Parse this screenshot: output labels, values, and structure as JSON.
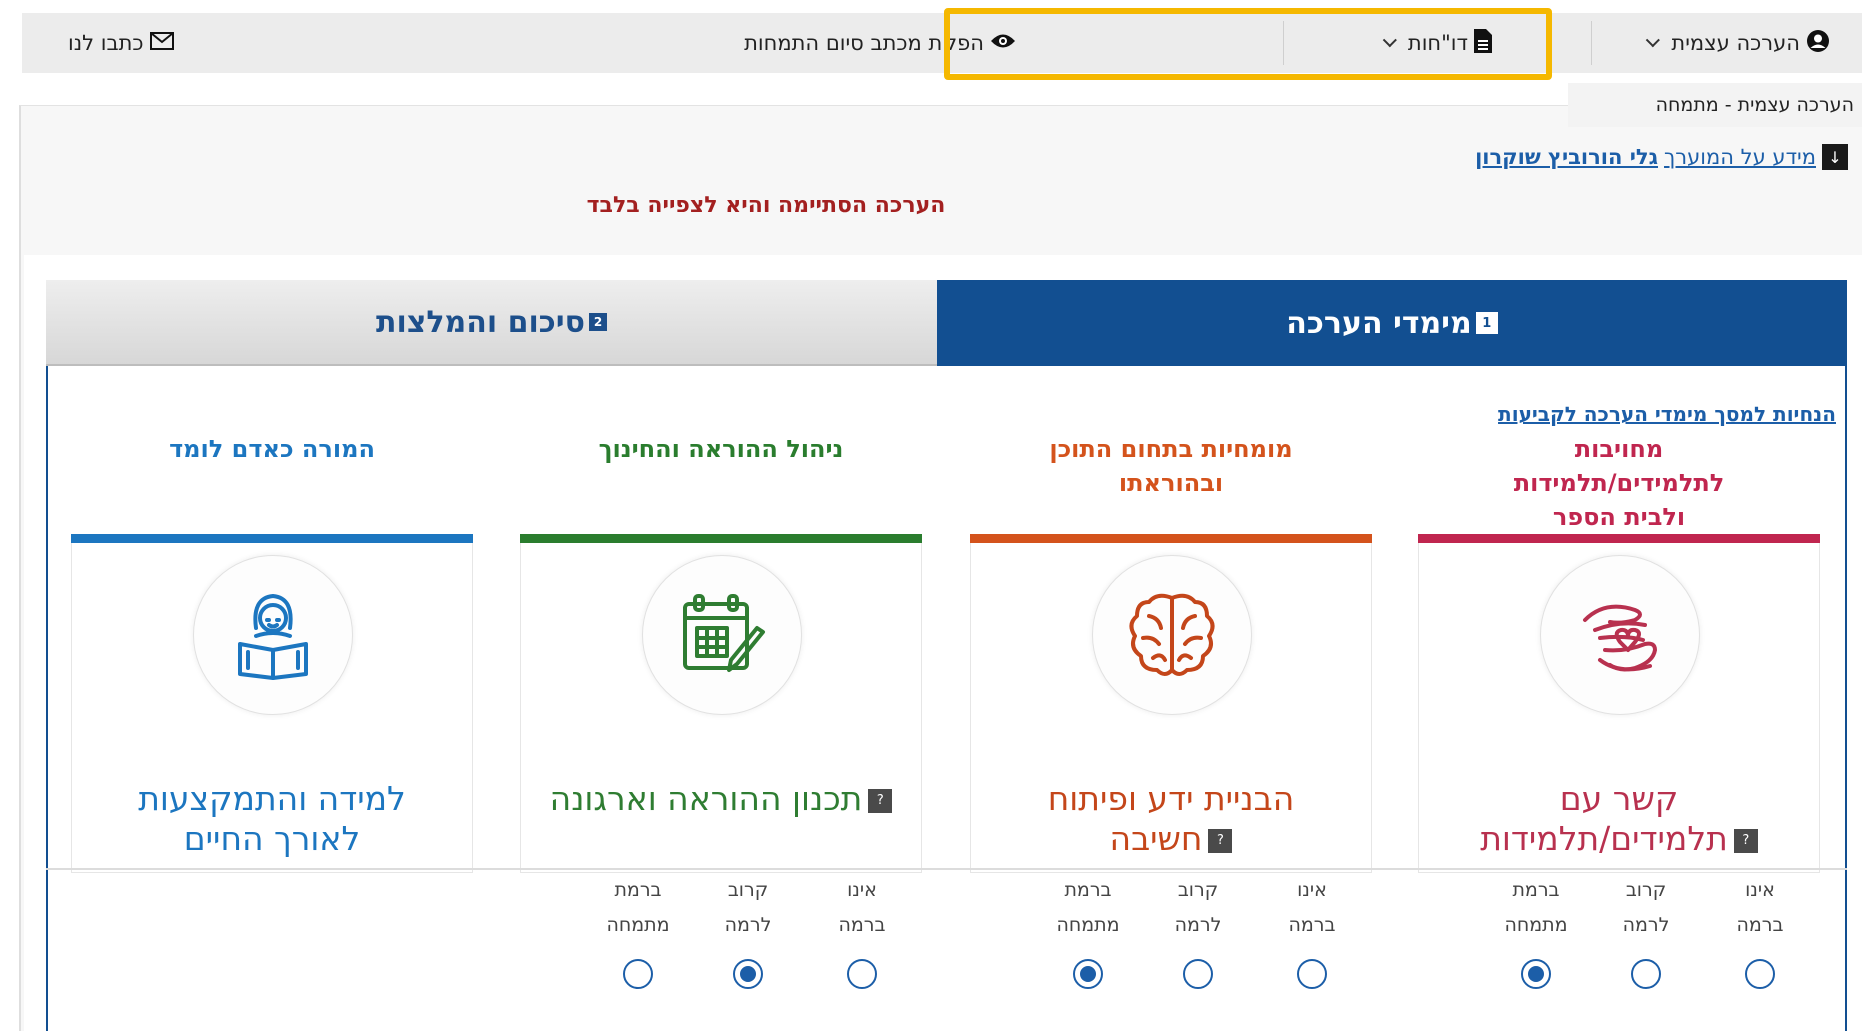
{
  "nav": {
    "self_eval": "הערכה עצמית",
    "reports": "דו\"חות",
    "completion_letter": "הפקת מכתב סיום התמחות",
    "contact": "כתבו לנו",
    "dropdown_item": "הערכה עצמית - מתמחה"
  },
  "appraisee": {
    "label": "מידע על המוערך",
    "name": "גלי הורוביץ שוקרון"
  },
  "status_message": "הערכה הסתיימה והיא לצפייה בלבד",
  "tabs": [
    {
      "num": "1",
      "label": "מימדי הערכה"
    },
    {
      "num": "2",
      "label": "סיכום והמלצות"
    }
  ],
  "guide_link": "הנחיות למסך מימדי הערכה לקביעות",
  "columns": [
    {
      "title": "מחויבות לתלמידים/תלמידות ולבית הספר",
      "title_lines": [
        "מחויבות",
        "לתלמידים/תלמידות",
        "ולבית הספר"
      ],
      "color": "#c0264f",
      "card_title_lines": [
        "קשר עם",
        "תלמידים/תלמידות"
      ],
      "icon": "heart-hands-icon",
      "has_help": true,
      "selected": "ברמת מתמחה"
    },
    {
      "title": "מומחיות בתחום התוכן ובהוראתו",
      "title_lines": [
        "מומחיות בתחום התוכן",
        "ובהוראתו"
      ],
      "color": "#d4531c",
      "card_title_lines": [
        "הבניית ידע ופיתוח",
        "חשיבה"
      ],
      "icon": "brain-icon",
      "has_help": true,
      "selected": "ברמת מתמחה"
    },
    {
      "title": "ניהול ההוראה והחינוך",
      "title_lines": [
        "ניהול ההוראה והחינוך"
      ],
      "color": "#2a7d2e",
      "card_title_lines": [
        "תכנון ההוראה וארגונה"
      ],
      "icon": "calendar-pencil-icon",
      "has_help": true,
      "selected": "קרוב לרמה"
    },
    {
      "title": "המורה כאדם לומד",
      "title_lines": [
        "המורה כאדם לומד"
      ],
      "color": "#1c76c0",
      "card_title_lines": [
        "למידה והתמקצעות",
        "לאורך החיים"
      ],
      "icon": "reader-icon",
      "has_help": false,
      "selected": null
    }
  ],
  "levels": [
    {
      "line1": "אינו",
      "line2": "ברמה"
    },
    {
      "line1": "קרוב",
      "line2": "לרמה"
    },
    {
      "line1": "ברמת",
      "line2": "מתמחה"
    }
  ],
  "selections": {
    "col0": 2,
    "col1": 2,
    "col2": 1
  },
  "help_glyph": "?"
}
